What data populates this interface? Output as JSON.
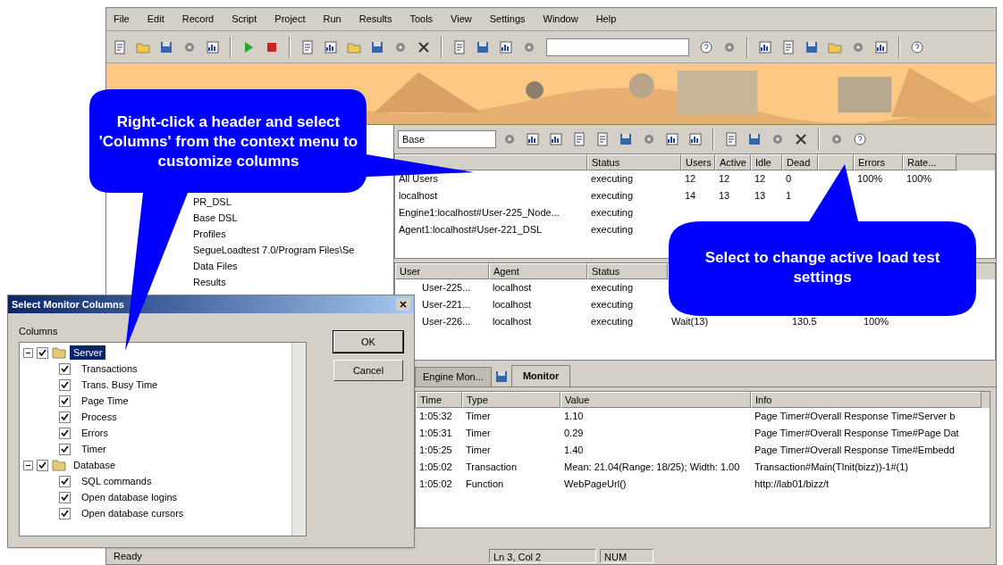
{
  "menu": [
    "File",
    "Edit",
    "Record",
    "Script",
    "Project",
    "Run",
    "Results",
    "Tools",
    "View",
    "Settings",
    "Window",
    "Help"
  ],
  "monitor_toolbar": {
    "combo": "Base"
  },
  "project_tree": [
    "PR_DSL",
    "Base DSL",
    "Profiles",
    "SegueLoadtest 7.0/Program Files\\Se",
    "Data Files",
    "Results"
  ],
  "agent_table": {
    "columns": [
      "",
      "Status",
      "Users",
      "Active",
      "Idle",
      "Dead",
      "",
      "Errors",
      "Rate..."
    ],
    "rows": [
      {
        "cells": [
          "All Users",
          "executing",
          "12",
          "12",
          "12",
          "0",
          "",
          "100%",
          "100%"
        ]
      },
      {
        "cells": [
          "localhost",
          "executing",
          "14",
          "13",
          "13",
          "1"
        ]
      },
      {
        "cells": [
          "Engine1:localhost#User-225_Node...",
          "executing"
        ]
      },
      {
        "cells": [
          "Agent1:localhost#User-221_DSL",
          "executing"
        ]
      }
    ]
  },
  "user_table": {
    "columns": [
      "User",
      "Agent",
      "Status"
    ],
    "rows": [
      {
        "cells": [
          "User-225...",
          "localhost",
          "executing"
        ]
      },
      {
        "cells": [
          "User-221...",
          "localhost",
          "executing"
        ]
      },
      {
        "cells": [
          "User-226...",
          "localhost",
          "executing",
          "Wait(13)",
          "130.5",
          "100%"
        ]
      }
    ]
  },
  "tabs": [
    {
      "label": "Engine Mon...",
      "selected": false
    },
    {
      "label": "Monitor",
      "selected": true
    }
  ],
  "log_table": {
    "columns": [
      "Time",
      "Type",
      "Value",
      "Info"
    ],
    "rows": [
      [
        "1:05:32",
        "Timer",
        "1.10",
        "Page Timer#Overall Response Time#Server b"
      ],
      [
        "1:05:31",
        "Timer",
        "0.29",
        "Page Timer#Overall Response Time#Page Dat"
      ],
      [
        "1:05:25",
        "Timer",
        "1.40",
        "Page Timer#Overall Response Time#Embedd"
      ],
      [
        "1:05:02",
        "Transaction",
        "Mean: 21.04(Range: 18/25); Width: 1.00",
        "Transaction#Main(TInit(bizz))-1#(1)"
      ],
      [
        "1:05:02",
        "Function",
        "WebPageUrl()",
        "http://lab01/bizz/t"
      ]
    ]
  },
  "status_bar": [
    "Ready",
    "Ln 3, Col 2",
    "NUM"
  ],
  "dialog": {
    "title": "Select Monitor Columns",
    "group_label": "Columns",
    "tree": [
      {
        "label": "Server",
        "checked": true,
        "expanded": true,
        "selected": true,
        "children": [
          {
            "label": "Transactions",
            "checked": true,
            "selected": false
          },
          {
            "label": "Trans. Busy Time",
            "checked": true,
            "selected": false
          },
          {
            "label": "Page Time",
            "checked": true,
            "selected": false
          },
          {
            "label": "Process",
            "checked": true,
            "selected": false
          },
          {
            "label": "Errors",
            "checked": true,
            "selected": false
          },
          {
            "label": "Timer",
            "checked": true,
            "selected": false
          }
        ]
      },
      {
        "label": "Database",
        "checked": true,
        "expanded": true,
        "selected": false,
        "children": [
          {
            "label": "SQL commands",
            "checked": true,
            "selected": false
          },
          {
            "label": "Open database logins",
            "checked": true,
            "selected": false
          },
          {
            "label": "Open database cursors",
            "checked": true,
            "selected": false
          }
        ]
      }
    ],
    "buttons": [
      "OK",
      "Cancel"
    ]
  },
  "callouts": [
    {
      "text": "Right-click a header and select 'Columns' from the context menu to customize columns"
    },
    {
      "text": "Select to change active load test settings"
    }
  ]
}
